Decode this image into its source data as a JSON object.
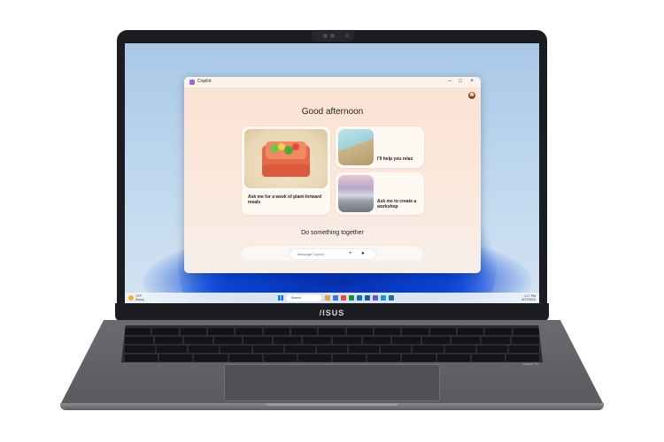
{
  "laptop": {
    "brand": "/ISUS",
    "badge": "Copilot+ PC"
  },
  "copilot_window": {
    "title": "Copilot",
    "window_controls": {
      "minimize": "–",
      "maximize": "□",
      "close": "×"
    },
    "greeting": "Good afternoon",
    "cards": [
      {
        "text": "Ask me for a week of plant-forward meals",
        "image_icon": "food-container-icon"
      },
      {
        "text": "I'll help you relax",
        "image_icon": "landscape-icon"
      },
      {
        "text": "Ask me to create a workshop",
        "image_icon": "rainbow-landscape-icon"
      }
    ],
    "together_heading": "Do something together",
    "composer": {
      "placeholder": "Message Copilot",
      "history_icon": "history-icon",
      "add_icon": "+",
      "mic_icon": "microphone-icon"
    }
  },
  "taskbar": {
    "weather_temp": "70°F",
    "weather_desc": "Sunny",
    "search_label": "Search",
    "time": "1:17 PM",
    "date": "6/27/2024",
    "app_colors": [
      "#e8a23a",
      "#2a7de1",
      "#e84c3d",
      "#1e8a3e",
      "#0a6ed1",
      "#2b5797",
      "#6a4fd8",
      "#0f9ae3",
      "#1d6fa5"
    ]
  },
  "colors": {
    "accent": "#0a7ae0",
    "window_bg": "#fbe2d4",
    "wallpaper_bloom": "#1556e8"
  }
}
